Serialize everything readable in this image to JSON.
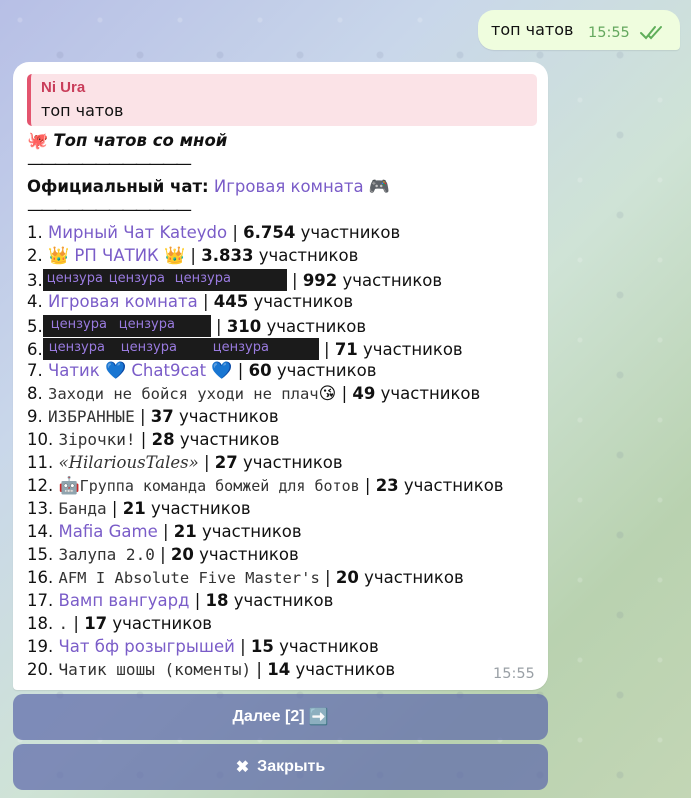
{
  "outgoing": {
    "text": "топ чатов",
    "time": "15:55"
  },
  "reply": {
    "name": "Ni Ura",
    "text": "топ чатов"
  },
  "header": {
    "emoji": "🐙",
    "title": "Топ чатов со мной",
    "separator": "————————————",
    "official_label": "Официальный чат:",
    "official_chat": "Игровая комната",
    "official_emoji": "🎮"
  },
  "chats": [
    {
      "rank": "1.",
      "name": "Мирный Чат Kateydo",
      "count": "6.754",
      "unit": "участников"
    },
    {
      "rank": "2.",
      "pre": "👑",
      "name": "РП ЧАТИК",
      "post": "👑",
      "count": "3.833",
      "unit": "участников"
    },
    {
      "rank": "3.",
      "redacted": [
        "цензура",
        "цензура",
        "цензура"
      ],
      "count": "992",
      "unit": "участников"
    },
    {
      "rank": "4.",
      "name": "Игровая комната",
      "count": "445",
      "unit": "участников"
    },
    {
      "rank": "5.",
      "redacted": [
        "цензура",
        "цензура"
      ],
      "count": "310",
      "unit": "участников"
    },
    {
      "rank": "6.",
      "redacted": [
        "цензура",
        "цензура",
        "цензура"
      ],
      "count": "71",
      "unit": "участников"
    },
    {
      "rank": "7.",
      "name": "Чатик",
      "heart": "💙",
      "name2": "Chat9cat",
      "post": "💙",
      "count": "60",
      "unit": "участников"
    },
    {
      "rank": "8.",
      "name": "Заходи не бойся уходи не плач",
      "post": "😘",
      "count": "49",
      "unit": "участников"
    },
    {
      "rank": "9.",
      "name": "ИЗБРАННЫЕ",
      "count": "37",
      "unit": "участников"
    },
    {
      "rank": "10.",
      "name": "Зірочки!",
      "count": "28",
      "unit": "участников"
    },
    {
      "rank": "11.",
      "name": "«HilariousTales»",
      "count": "27",
      "unit": "участников"
    },
    {
      "rank": "12.",
      "pre": "🤖",
      "name": "Группа команда бомжей для ботов",
      "count": "23",
      "unit": "участников"
    },
    {
      "rank": "13.",
      "name": "Банда",
      "count": "21",
      "unit": "участников"
    },
    {
      "rank": "14.",
      "name": "Mafia Game",
      "count": "21",
      "unit": "участников"
    },
    {
      "rank": "15.",
      "name": "Залупа 2.0",
      "count": "20",
      "unit": "участников"
    },
    {
      "rank": "16.",
      "name": "AFM I Absolute Five Master's",
      "count": "20",
      "unit": "участников"
    },
    {
      "rank": "17.",
      "name": "Вамп вангуард",
      "count": "18",
      "unit": "участников"
    },
    {
      "rank": "18.",
      "name": ".",
      "count": "17",
      "unit": "участников"
    },
    {
      "rank": "19.",
      "name": "Чат бф розыгрышей",
      "count": "15",
      "unit": "участников"
    },
    {
      "rank": "20.",
      "name": "Чатик шошы (коменты)",
      "count": "14",
      "unit": "участников"
    }
  ],
  "incoming_time": "15:55",
  "buttons": {
    "next_label": "Далее [2]",
    "next_icon": "➡️",
    "close_icon": "✖",
    "close_label": "Закрыть"
  },
  "colors": {
    "link": "#7a5cc8",
    "reply_accent": "#e3546e",
    "button_bg": "#5e69aa"
  }
}
